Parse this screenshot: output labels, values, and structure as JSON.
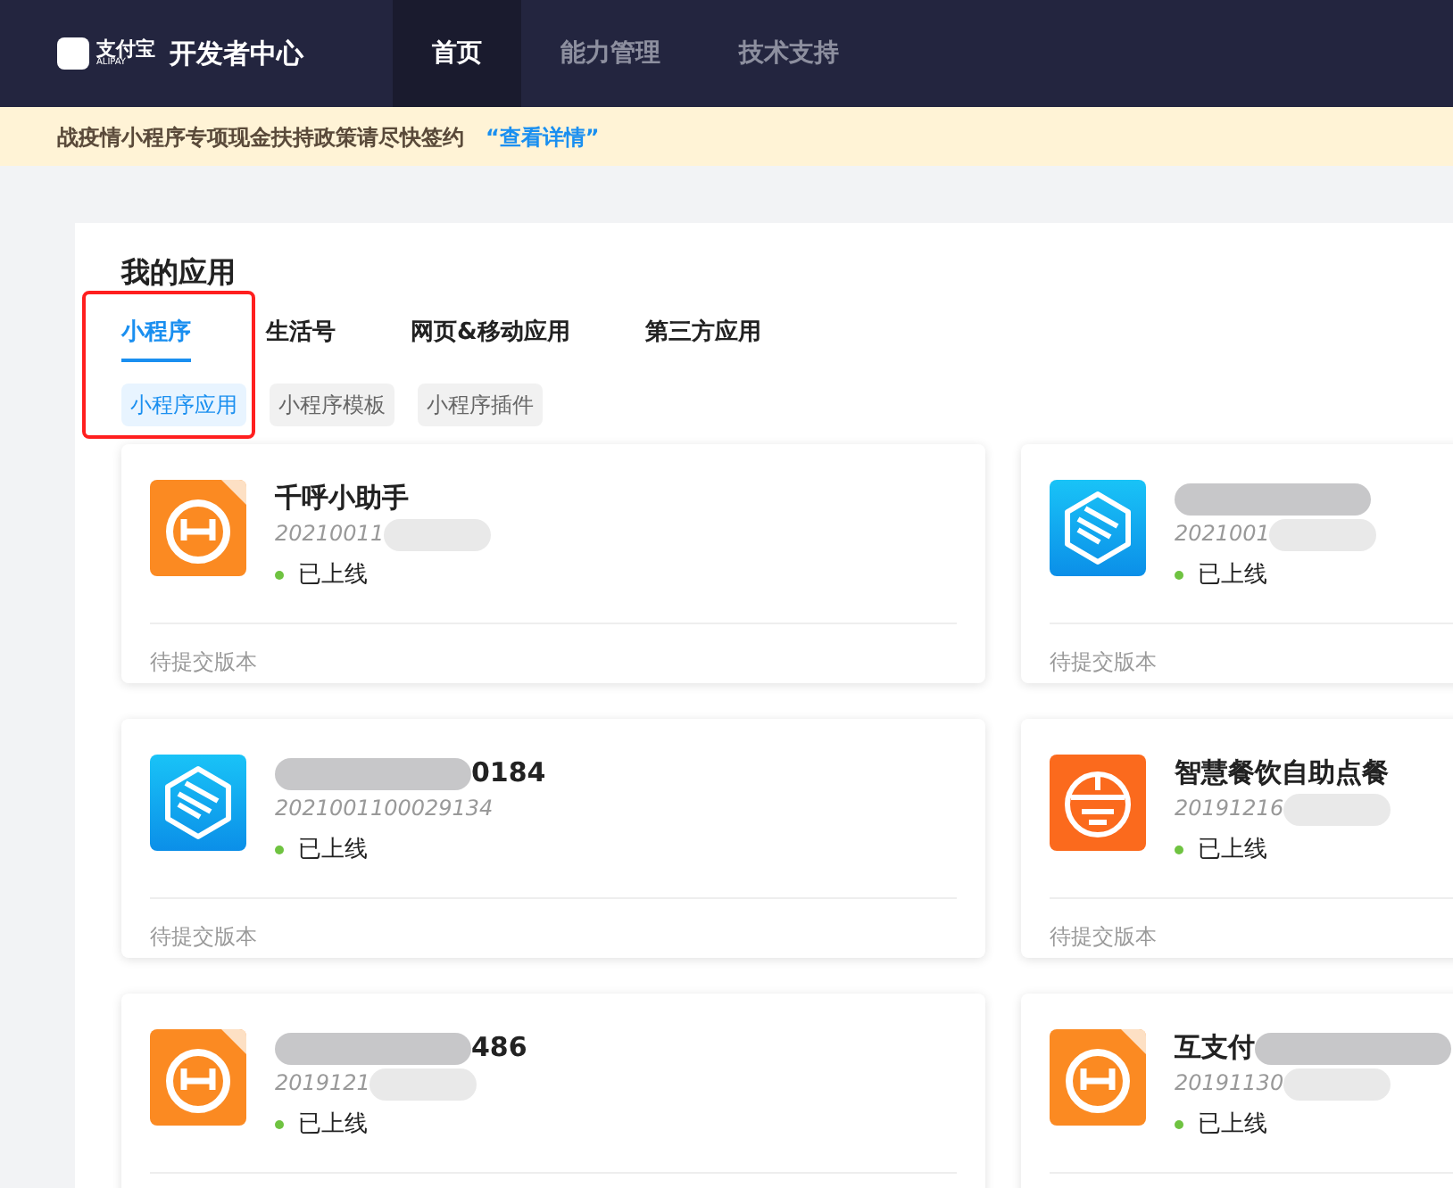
{
  "header": {
    "logo_text": "支付宝",
    "logo_sub": "ALIPAY",
    "title": "开发者中心",
    "nav": [
      {
        "label": "首页",
        "selected": true
      },
      {
        "label": "能力管理",
        "selected": false
      },
      {
        "label": "技术支持",
        "selected": false
      }
    ]
  },
  "notice": {
    "text": "战疫情小程序专项现金扶持政策请尽快签约",
    "link": "“查看详情”"
  },
  "section_title": "我的应用",
  "tabs": [
    {
      "label": "小程序",
      "selected": true
    },
    {
      "label": "生活号",
      "selected": false
    },
    {
      "label": "网页&移动应用",
      "selected": false
    },
    {
      "label": "第三方应用",
      "selected": false
    }
  ],
  "subtabs": [
    {
      "label": "小程序应用",
      "selected": true
    },
    {
      "label": "小程序模板",
      "selected": false
    },
    {
      "label": "小程序插件",
      "selected": false
    }
  ],
  "highlight": true,
  "apps": [
    {
      "kind": "ring",
      "name": "千呼小助手",
      "name_blurred": false,
      "id": "20210011",
      "id_blurred": true,
      "status": "已上线",
      "footer": "待提交版本"
    },
    {
      "kind": "hexagon",
      "name_blurred": true,
      "name_before_blur": false,
      "id": "2021001",
      "id_blurred": true,
      "status": "已上线",
      "footer": "待提交版本"
    },
    {
      "kind": "hexagon",
      "name": "0184",
      "name_blurred": true,
      "name_before_blur": false,
      "id": "2021001100029134",
      "id_blurred": false,
      "status": "已上线",
      "footer": "待提交版本"
    },
    {
      "kind": "bowl",
      "name": "智慧餐饮自助点餐",
      "name_blurred": false,
      "id": "20191216",
      "id_blurred": true,
      "status": "已上线",
      "footer": "待提交版本"
    },
    {
      "kind": "ring",
      "name": "486",
      "name_blurred": true,
      "name_before_blur": false,
      "id": "2019121",
      "id_blurred": true,
      "status": "已上线"
    },
    {
      "kind": "ring",
      "name": "互支付",
      "name_blurred": true,
      "name_before_blur": true,
      "id": "20191130",
      "id_blurred": true,
      "status": "已上线"
    }
  ]
}
